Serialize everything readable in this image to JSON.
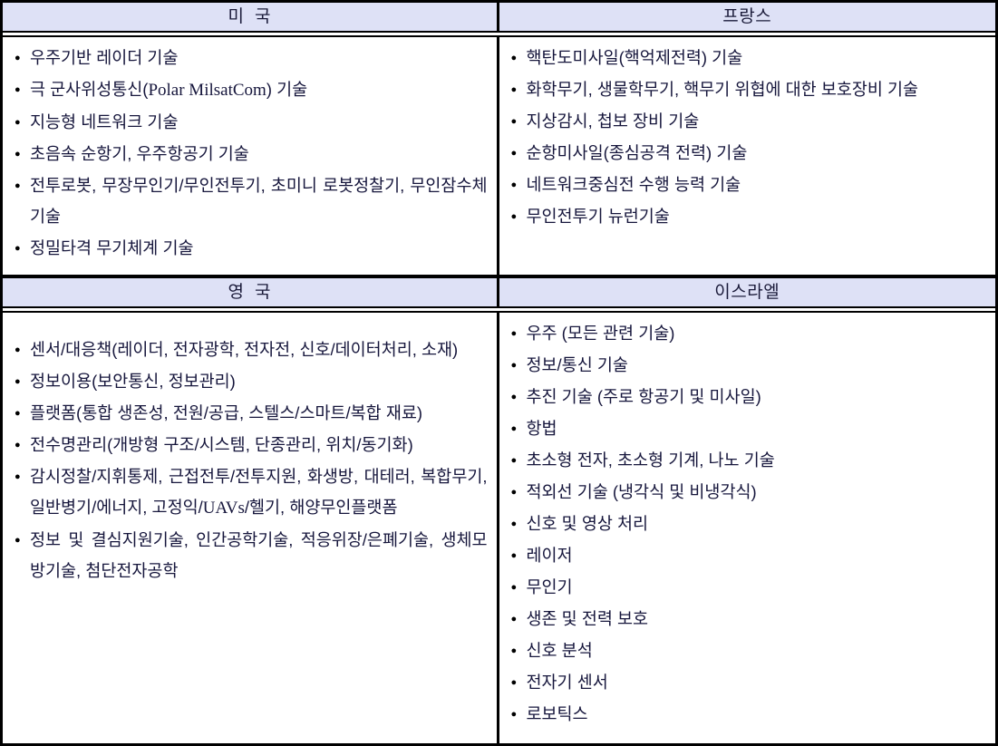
{
  "document": {
    "type": "table",
    "columns": 2,
    "rows": 2,
    "header_fill": "#dee1f6",
    "border_color": "#000000",
    "text_color": "#16163c"
  },
  "sections": [
    {
      "id": "row-1",
      "cells": [
        {
          "id": "usa",
          "header": "미  국",
          "items": [
            {
              "text": "우주기반 레이더 기술"
            },
            {
              "text": "극 군사위성통신(Polar MilsatCom) 기술",
              "latin": "(Polar  MilsatCom)"
            },
            {
              "text": "지능형 네트워크 기술"
            },
            {
              "text": "초음속 순항기, 우주항공기 기술"
            },
            {
              "text": "전투로봇, 무장무인기/무인전투기, 초미니 로봇정찰기, 무인잠수체 기술"
            },
            {
              "text": "정밀타격 무기체계 기술"
            }
          ]
        },
        {
          "id": "france",
          "header": "프랑스",
          "items": [
            {
              "text": "핵탄도미사일(핵억제전력) 기술"
            },
            {
              "text": "화학무기, 생물학무기, 핵무기 위협에 대한 보호장비 기술"
            },
            {
              "text": "지상감시, 첩보 장비 기술"
            },
            {
              "text": "순항미사일(종심공격 전력) 기술"
            },
            {
              "text": "네트워크중심전 수행 능력 기술"
            },
            {
              "text": "무인전투기 뉴런기술"
            }
          ]
        }
      ]
    },
    {
      "id": "row-2",
      "cells": [
        {
          "id": "uk",
          "header": "영  국",
          "items": [
            {
              "text": "센서/대응책(레이더, 전자광학, 전자전, 신호/데이터처리, 소재)"
            },
            {
              "text": "정보이용(보안통신, 정보관리)"
            },
            {
              "text": "플랫폼(통합 생존성, 전원/공급, 스텔스/스마트/복합 재료)"
            },
            {
              "text": "전수명관리(개방형 구조/시스템, 단종관리, 위치/동기화)"
            },
            {
              "text": "감시정찰/지휘통제, 근접전투/전투지원, 화생방, 대테러, 복합무기, 일반병기/에너지, 고정익/UAVs/헬기, 해양무인플랫폼",
              "latin": "UAVs"
            },
            {
              "text": "정보 및 결심지원기술, 인간공학기술, 적응위장/은폐기술, 생체모방기술, 첨단전자공학"
            }
          ]
        },
        {
          "id": "israel",
          "header": "이스라엘",
          "items": [
            {
              "text": "우주 (모든 관련 기술)"
            },
            {
              "text": "정보/통신 기술"
            },
            {
              "text": "추진 기술 (주로 항공기 및 미사일)"
            },
            {
              "text": "항법"
            },
            {
              "text": "초소형 전자, 초소형 기계, 나노 기술"
            },
            {
              "text": "적외선 기술 (냉각식 및 비냉각식)"
            },
            {
              "text": "신호 및 영상 처리"
            },
            {
              "text": "레이저"
            },
            {
              "text": "무인기"
            },
            {
              "text": "생존 및 전력 보호"
            },
            {
              "text": "신호 분석"
            },
            {
              "text": "전자기 센서"
            },
            {
              "text": "로보틱스"
            }
          ]
        }
      ]
    }
  ]
}
